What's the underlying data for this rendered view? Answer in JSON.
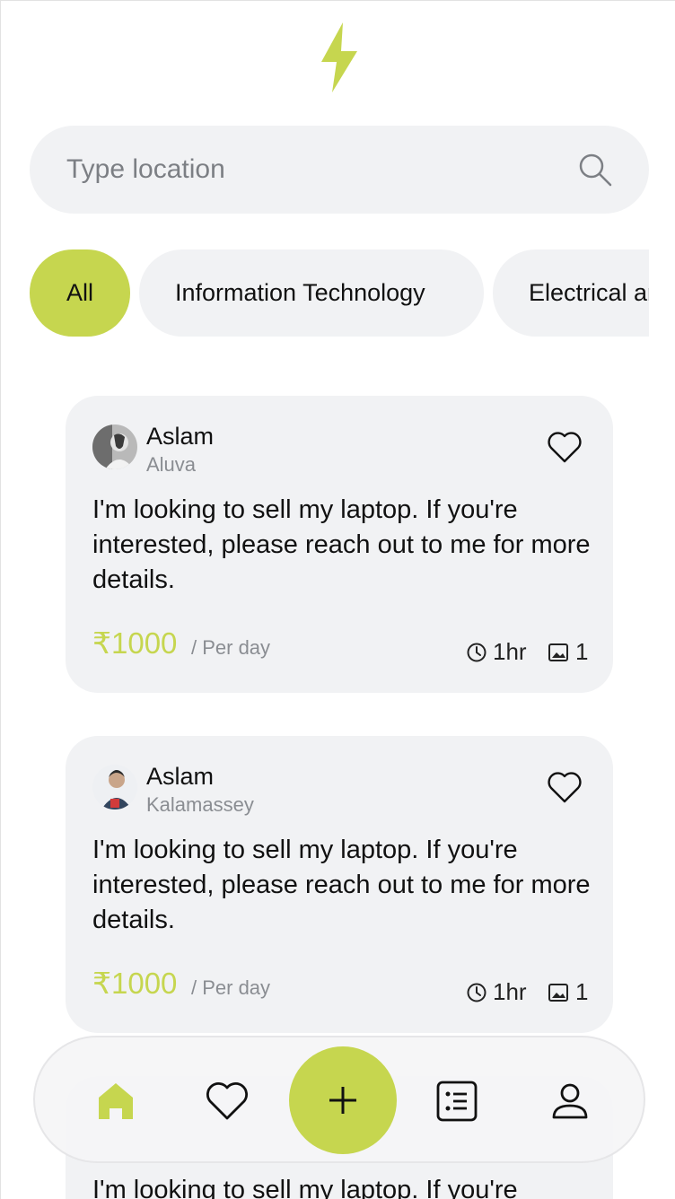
{
  "brand": {
    "accent": "#c6d64f",
    "logo_icon": "lightning-bolt-icon"
  },
  "search": {
    "placeholder": "Type location",
    "value": "",
    "icon": "search-icon"
  },
  "categories": [
    {
      "label": "All",
      "active": true
    },
    {
      "label": "Information Technology",
      "active": false
    },
    {
      "label": "Electrical and",
      "active": false
    }
  ],
  "posts": [
    {
      "name": "Aslam",
      "location": "Aluva",
      "message": "I'm looking to sell my laptop. If you're interested, please reach out to me for more details.",
      "price": "₹1000",
      "unit": "/ Per day",
      "time": "1hr",
      "image_count": "1"
    },
    {
      "name": "Aslam",
      "location": "Kalamassey",
      "message": "I'm looking to sell my laptop. If you're interested, please reach out to me for more details.",
      "price": "₹1000",
      "unit": "/ Per day",
      "time": "1hr",
      "image_count": "1"
    },
    {
      "message": "I'm looking to sell my laptop. If you're"
    }
  ],
  "nav": {
    "items": [
      "home-icon",
      "favorites-icon",
      "add-icon",
      "list-icon",
      "profile-icon"
    ],
    "active": "home-icon"
  }
}
